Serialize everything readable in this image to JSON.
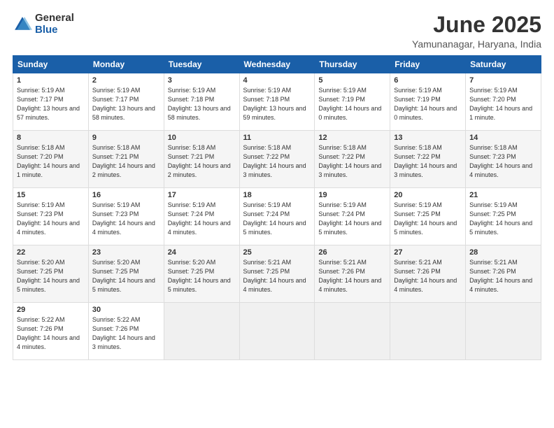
{
  "logo": {
    "general": "General",
    "blue": "Blue"
  },
  "title": "June 2025",
  "location": "Yamunanagar, Haryana, India",
  "weekdays": [
    "Sunday",
    "Monday",
    "Tuesday",
    "Wednesday",
    "Thursday",
    "Friday",
    "Saturday"
  ],
  "weeks": [
    [
      {
        "day": "1",
        "sunrise": "Sunrise: 5:19 AM",
        "sunset": "Sunset: 7:17 PM",
        "daylight": "Daylight: 13 hours and 57 minutes."
      },
      {
        "day": "2",
        "sunrise": "Sunrise: 5:19 AM",
        "sunset": "Sunset: 7:17 PM",
        "daylight": "Daylight: 13 hours and 58 minutes."
      },
      {
        "day": "3",
        "sunrise": "Sunrise: 5:19 AM",
        "sunset": "Sunset: 7:18 PM",
        "daylight": "Daylight: 13 hours and 58 minutes."
      },
      {
        "day": "4",
        "sunrise": "Sunrise: 5:19 AM",
        "sunset": "Sunset: 7:18 PM",
        "daylight": "Daylight: 13 hours and 59 minutes."
      },
      {
        "day": "5",
        "sunrise": "Sunrise: 5:19 AM",
        "sunset": "Sunset: 7:19 PM",
        "daylight": "Daylight: 14 hours and 0 minutes."
      },
      {
        "day": "6",
        "sunrise": "Sunrise: 5:19 AM",
        "sunset": "Sunset: 7:19 PM",
        "daylight": "Daylight: 14 hours and 0 minutes."
      },
      {
        "day": "7",
        "sunrise": "Sunrise: 5:19 AM",
        "sunset": "Sunset: 7:20 PM",
        "daylight": "Daylight: 14 hours and 1 minute."
      }
    ],
    [
      {
        "day": "8",
        "sunrise": "Sunrise: 5:18 AM",
        "sunset": "Sunset: 7:20 PM",
        "daylight": "Daylight: 14 hours and 1 minute."
      },
      {
        "day": "9",
        "sunrise": "Sunrise: 5:18 AM",
        "sunset": "Sunset: 7:21 PM",
        "daylight": "Daylight: 14 hours and 2 minutes."
      },
      {
        "day": "10",
        "sunrise": "Sunrise: 5:18 AM",
        "sunset": "Sunset: 7:21 PM",
        "daylight": "Daylight: 14 hours and 2 minutes."
      },
      {
        "day": "11",
        "sunrise": "Sunrise: 5:18 AM",
        "sunset": "Sunset: 7:22 PM",
        "daylight": "Daylight: 14 hours and 3 minutes."
      },
      {
        "day": "12",
        "sunrise": "Sunrise: 5:18 AM",
        "sunset": "Sunset: 7:22 PM",
        "daylight": "Daylight: 14 hours and 3 minutes."
      },
      {
        "day": "13",
        "sunrise": "Sunrise: 5:18 AM",
        "sunset": "Sunset: 7:22 PM",
        "daylight": "Daylight: 14 hours and 3 minutes."
      },
      {
        "day": "14",
        "sunrise": "Sunrise: 5:18 AM",
        "sunset": "Sunset: 7:23 PM",
        "daylight": "Daylight: 14 hours and 4 minutes."
      }
    ],
    [
      {
        "day": "15",
        "sunrise": "Sunrise: 5:19 AM",
        "sunset": "Sunset: 7:23 PM",
        "daylight": "Daylight: 14 hours and 4 minutes."
      },
      {
        "day": "16",
        "sunrise": "Sunrise: 5:19 AM",
        "sunset": "Sunset: 7:23 PM",
        "daylight": "Daylight: 14 hours and 4 minutes."
      },
      {
        "day": "17",
        "sunrise": "Sunrise: 5:19 AM",
        "sunset": "Sunset: 7:24 PM",
        "daylight": "Daylight: 14 hours and 4 minutes."
      },
      {
        "day": "18",
        "sunrise": "Sunrise: 5:19 AM",
        "sunset": "Sunset: 7:24 PM",
        "daylight": "Daylight: 14 hours and 5 minutes."
      },
      {
        "day": "19",
        "sunrise": "Sunrise: 5:19 AM",
        "sunset": "Sunset: 7:24 PM",
        "daylight": "Daylight: 14 hours and 5 minutes."
      },
      {
        "day": "20",
        "sunrise": "Sunrise: 5:19 AM",
        "sunset": "Sunset: 7:25 PM",
        "daylight": "Daylight: 14 hours and 5 minutes."
      },
      {
        "day": "21",
        "sunrise": "Sunrise: 5:19 AM",
        "sunset": "Sunset: 7:25 PM",
        "daylight": "Daylight: 14 hours and 5 minutes."
      }
    ],
    [
      {
        "day": "22",
        "sunrise": "Sunrise: 5:20 AM",
        "sunset": "Sunset: 7:25 PM",
        "daylight": "Daylight: 14 hours and 5 minutes."
      },
      {
        "day": "23",
        "sunrise": "Sunrise: 5:20 AM",
        "sunset": "Sunset: 7:25 PM",
        "daylight": "Daylight: 14 hours and 5 minutes."
      },
      {
        "day": "24",
        "sunrise": "Sunrise: 5:20 AM",
        "sunset": "Sunset: 7:25 PM",
        "daylight": "Daylight: 14 hours and 5 minutes."
      },
      {
        "day": "25",
        "sunrise": "Sunrise: 5:21 AM",
        "sunset": "Sunset: 7:25 PM",
        "daylight": "Daylight: 14 hours and 4 minutes."
      },
      {
        "day": "26",
        "sunrise": "Sunrise: 5:21 AM",
        "sunset": "Sunset: 7:26 PM",
        "daylight": "Daylight: 14 hours and 4 minutes."
      },
      {
        "day": "27",
        "sunrise": "Sunrise: 5:21 AM",
        "sunset": "Sunset: 7:26 PM",
        "daylight": "Daylight: 14 hours and 4 minutes."
      },
      {
        "day": "28",
        "sunrise": "Sunrise: 5:21 AM",
        "sunset": "Sunset: 7:26 PM",
        "daylight": "Daylight: 14 hours and 4 minutes."
      }
    ],
    [
      {
        "day": "29",
        "sunrise": "Sunrise: 5:22 AM",
        "sunset": "Sunset: 7:26 PM",
        "daylight": "Daylight: 14 hours and 4 minutes."
      },
      {
        "day": "30",
        "sunrise": "Sunrise: 5:22 AM",
        "sunset": "Sunset: 7:26 PM",
        "daylight": "Daylight: 14 hours and 3 minutes."
      },
      null,
      null,
      null,
      null,
      null
    ]
  ]
}
